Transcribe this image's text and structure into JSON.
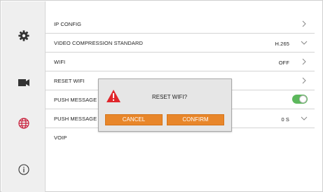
{
  "settings": {
    "rows": [
      {
        "label": "IP CONFIG",
        "value": "",
        "control": "chevron-right"
      },
      {
        "label": "VIDEO COMPRESSION STANDARD",
        "value": "H.265",
        "control": "chevron-down"
      },
      {
        "label": "WIFI",
        "value": "OFF",
        "control": "chevron-right"
      },
      {
        "label": "RESET WIFI",
        "value": "",
        "control": "chevron-right"
      },
      {
        "label": "PUSH MESSAGE",
        "value": "",
        "control": "toggle-on"
      },
      {
        "label": "PUSH MESSAGE",
        "value": "0 S",
        "control": "chevron-down"
      },
      {
        "label": "VOIP",
        "value": "",
        "control": "none"
      }
    ]
  },
  "sidebar": {
    "icons": [
      "gear-icon",
      "camera-icon",
      "globe-icon",
      "info-icon"
    ],
    "selected": "globe-icon"
  },
  "dialog": {
    "title": "RESET WIFI?",
    "cancel_label": "CANCEL",
    "confirm_label": "CONFIRM"
  },
  "colors": {
    "accent": "#e8862a",
    "toggle_on": "#5cb85c",
    "warning": "#e0262b",
    "globe_selected": "#c81e3a"
  }
}
